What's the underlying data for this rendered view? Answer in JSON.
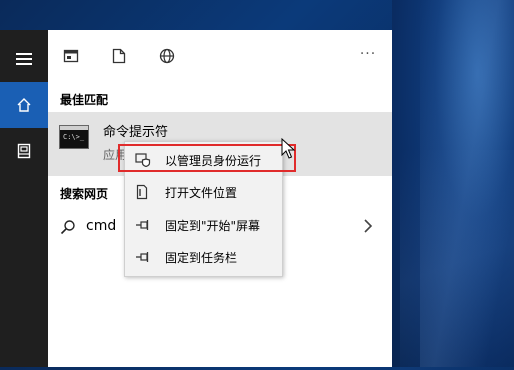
{
  "toolbar": {
    "more_label": "···"
  },
  "sections": {
    "best_match": "最佳匹配",
    "web_search": "搜索网页"
  },
  "best_match_item": {
    "title": "命令提示符",
    "subtitle": "应用",
    "icon_prompt": "C:\\>_"
  },
  "web_search_item": {
    "query": "cmd"
  },
  "context_menu": {
    "items": [
      {
        "label": "以管理员身份运行",
        "icon": "admin-shield-icon"
      },
      {
        "label": "打开文件位置",
        "icon": "file-location-icon"
      },
      {
        "label": "固定到\"开始\"屏幕",
        "icon": "pin-icon"
      },
      {
        "label": "固定到任务栏",
        "icon": "pin-icon"
      }
    ]
  },
  "colors": {
    "accent": "#1a5fb4",
    "highlight": "#e02b2b",
    "rail": "#1f1f1f"
  }
}
